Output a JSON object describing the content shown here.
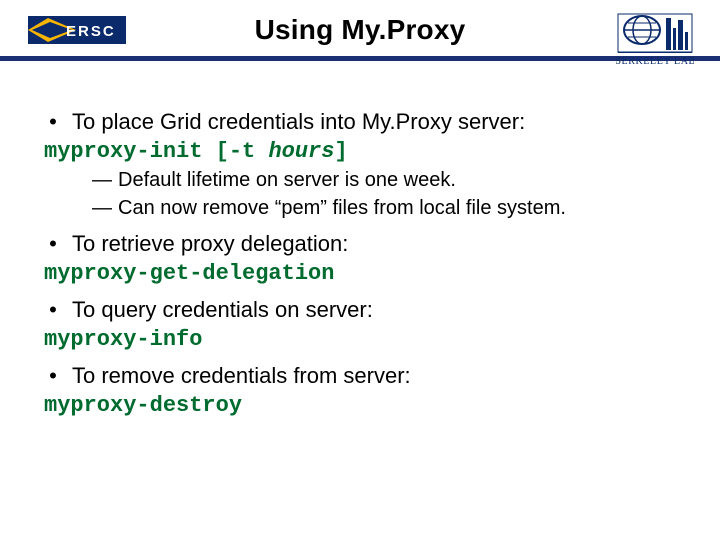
{
  "title": "Using My.Proxy",
  "logos": {
    "left_alt": "NERSC",
    "right_alt": "Berkeley Lab"
  },
  "bullets": [
    {
      "text": "To place Grid credentials into My.Proxy server:",
      "code_parts": {
        "a": "myproxy-init [-t ",
        "b": "hours",
        "c": "]"
      },
      "subs": [
        "Default lifetime on server is one week.",
        "Can now remove “pem” files from local file system."
      ]
    },
    {
      "text": "To retrieve proxy delegation:",
      "code": "myproxy-get-delegation"
    },
    {
      "text": "To query credentials on server:",
      "code": "myproxy-info"
    },
    {
      "text": "To remove credentials from server:",
      "code": "myproxy-destroy"
    }
  ]
}
